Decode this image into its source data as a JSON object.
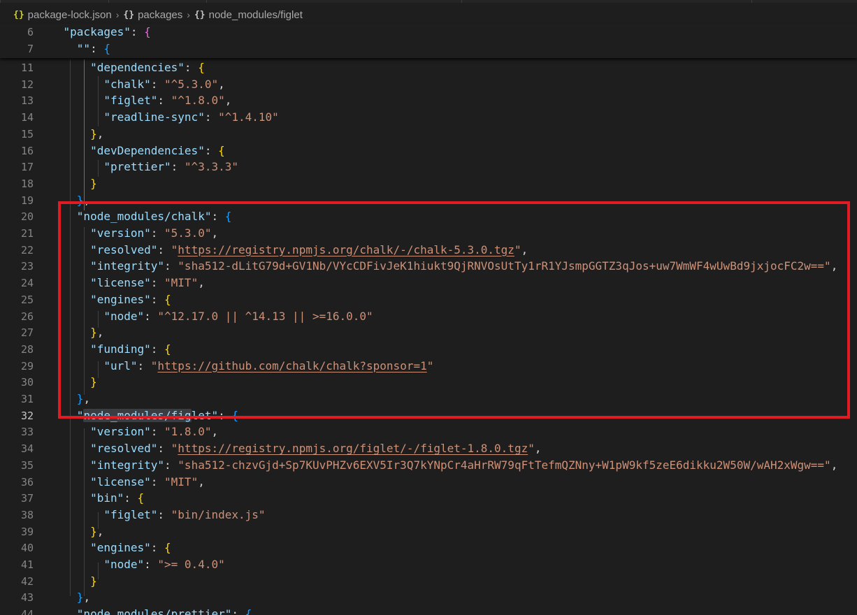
{
  "breadcrumb": {
    "file": "package-lock.json",
    "crumb1": "packages",
    "crumb2": "node_modules/figlet",
    "icon_glyph": "{}",
    "separator": "›"
  },
  "sticky_lines": [
    {
      "n": "6",
      "code": [
        [
          "    ",
          "p"
        ],
        [
          "\"packages\"",
          "k"
        ],
        [
          ": ",
          "p"
        ],
        [
          "{",
          "b2"
        ]
      ]
    },
    {
      "n": "7",
      "code": [
        [
          "      ",
          "p"
        ],
        [
          "\"\"",
          "k"
        ],
        [
          ": ",
          "p"
        ],
        [
          "{",
          "b3"
        ]
      ]
    }
  ],
  "active_line": "32",
  "lines": [
    {
      "n": "11",
      "code": [
        [
          "        ",
          "p"
        ],
        [
          "\"dependencies\"",
          "k"
        ],
        [
          ": ",
          "p"
        ],
        [
          "{",
          "b1"
        ]
      ]
    },
    {
      "n": "12",
      "code": [
        [
          "          ",
          "p"
        ],
        [
          "\"chalk\"",
          "k"
        ],
        [
          ": ",
          "p"
        ],
        [
          "\"^5.3.0\"",
          "s"
        ],
        [
          ",",
          "p"
        ]
      ]
    },
    {
      "n": "13",
      "code": [
        [
          "          ",
          "p"
        ],
        [
          "\"figlet\"",
          "k"
        ],
        [
          ": ",
          "p"
        ],
        [
          "\"^1.8.0\"",
          "s"
        ],
        [
          ",",
          "p"
        ]
      ]
    },
    {
      "n": "14",
      "code": [
        [
          "          ",
          "p"
        ],
        [
          "\"readline-sync\"",
          "k"
        ],
        [
          ": ",
          "p"
        ],
        [
          "\"^1.4.10\"",
          "s"
        ]
      ]
    },
    {
      "n": "15",
      "code": [
        [
          "        ",
          "p"
        ],
        [
          "}",
          "b1"
        ],
        [
          ",",
          "p"
        ]
      ]
    },
    {
      "n": "16",
      "code": [
        [
          "        ",
          "p"
        ],
        [
          "\"devDependencies\"",
          "k"
        ],
        [
          ": ",
          "p"
        ],
        [
          "{",
          "b1"
        ]
      ]
    },
    {
      "n": "17",
      "code": [
        [
          "          ",
          "p"
        ],
        [
          "\"prettier\"",
          "k"
        ],
        [
          ": ",
          "p"
        ],
        [
          "\"^3.3.3\"",
          "s"
        ]
      ]
    },
    {
      "n": "18",
      "code": [
        [
          "        ",
          "p"
        ],
        [
          "}",
          "b1"
        ]
      ]
    },
    {
      "n": "19",
      "code": [
        [
          "      ",
          "p"
        ],
        [
          "}",
          "b3"
        ],
        [
          ",",
          "p"
        ]
      ]
    },
    {
      "n": "20",
      "code": [
        [
          "      ",
          "p"
        ],
        [
          "\"node_modules/chalk\"",
          "k"
        ],
        [
          ": ",
          "p"
        ],
        [
          "{",
          "b3"
        ]
      ]
    },
    {
      "n": "21",
      "code": [
        [
          "        ",
          "p"
        ],
        [
          "\"version\"",
          "k"
        ],
        [
          ": ",
          "p"
        ],
        [
          "\"5.3.0\"",
          "s"
        ],
        [
          ",",
          "p"
        ]
      ]
    },
    {
      "n": "22",
      "code": [
        [
          "        ",
          "p"
        ],
        [
          "\"resolved\"",
          "k"
        ],
        [
          ": ",
          "p"
        ],
        [
          "\"",
          "s"
        ],
        [
          "https://registry.npmjs.org/chalk/-/chalk-5.3.0.tgz",
          "u"
        ],
        [
          "\"",
          "s"
        ],
        [
          ",",
          "p"
        ]
      ]
    },
    {
      "n": "23",
      "code": [
        [
          "        ",
          "p"
        ],
        [
          "\"integrity\"",
          "k"
        ],
        [
          ": ",
          "p"
        ],
        [
          "\"sha512-dLitG79d+GV1Nb/VYcCDFivJeK1hiukt9QjRNVOsUtTy1rR1YJsmpGGTZ3qJos+uw7WmWF4wUwBd9jxjocFC2w==\"",
          "s"
        ],
        [
          ",",
          "p"
        ]
      ]
    },
    {
      "n": "24",
      "code": [
        [
          "        ",
          "p"
        ],
        [
          "\"license\"",
          "k"
        ],
        [
          ": ",
          "p"
        ],
        [
          "\"MIT\"",
          "s"
        ],
        [
          ",",
          "p"
        ]
      ]
    },
    {
      "n": "25",
      "code": [
        [
          "        ",
          "p"
        ],
        [
          "\"engines\"",
          "k"
        ],
        [
          ": ",
          "p"
        ],
        [
          "{",
          "b1"
        ]
      ]
    },
    {
      "n": "26",
      "code": [
        [
          "          ",
          "p"
        ],
        [
          "\"node\"",
          "k"
        ],
        [
          ": ",
          "p"
        ],
        [
          "\"^12.17.0 || ^14.13 || >=16.0.0\"",
          "s"
        ]
      ]
    },
    {
      "n": "27",
      "code": [
        [
          "        ",
          "p"
        ],
        [
          "}",
          "b1"
        ],
        [
          ",",
          "p"
        ]
      ]
    },
    {
      "n": "28",
      "code": [
        [
          "        ",
          "p"
        ],
        [
          "\"funding\"",
          "k"
        ],
        [
          ": ",
          "p"
        ],
        [
          "{",
          "b1"
        ]
      ]
    },
    {
      "n": "29",
      "code": [
        [
          "          ",
          "p"
        ],
        [
          "\"url\"",
          "k"
        ],
        [
          ": ",
          "p"
        ],
        [
          "\"",
          "s"
        ],
        [
          "https://github.com/chalk/chalk?sponsor=1",
          "u"
        ],
        [
          "\"",
          "s"
        ]
      ]
    },
    {
      "n": "30",
      "code": [
        [
          "        ",
          "p"
        ],
        [
          "}",
          "b1"
        ]
      ]
    },
    {
      "n": "31",
      "code": [
        [
          "      ",
          "p"
        ],
        [
          "}",
          "b3"
        ],
        [
          ",",
          "p"
        ]
      ]
    },
    {
      "n": "32",
      "code": [
        [
          "      ",
          "p"
        ],
        [
          "\"",
          "k"
        ],
        [
          "node_modules/fig",
          "k hl"
        ],
        [
          "let\"",
          "k"
        ],
        [
          ": ",
          "p"
        ],
        [
          "{",
          "b3"
        ]
      ]
    },
    {
      "n": "33",
      "code": [
        [
          "        ",
          "p"
        ],
        [
          "\"version\"",
          "k"
        ],
        [
          ": ",
          "p"
        ],
        [
          "\"1.8.0\"",
          "s"
        ],
        [
          ",",
          "p"
        ]
      ]
    },
    {
      "n": "34",
      "code": [
        [
          "        ",
          "p"
        ],
        [
          "\"resolved\"",
          "k"
        ],
        [
          ": ",
          "p"
        ],
        [
          "\"",
          "s"
        ],
        [
          "https://registry.npmjs.org/figlet/-/figlet-1.8.0.tgz",
          "u"
        ],
        [
          "\"",
          "s"
        ],
        [
          ",",
          "p"
        ]
      ]
    },
    {
      "n": "35",
      "code": [
        [
          "        ",
          "p"
        ],
        [
          "\"integrity\"",
          "k"
        ],
        [
          ": ",
          "p"
        ],
        [
          "\"sha512-chzvGjd+Sp7KUvPHZv6EXV5Ir3Q7kYNpCr4aHrRW79qFtTefmQZNny+W1pW9kf5zeE6dikku2W50W/wAH2xWgw==\"",
          "s"
        ],
        [
          ",",
          "p"
        ]
      ]
    },
    {
      "n": "36",
      "code": [
        [
          "        ",
          "p"
        ],
        [
          "\"license\"",
          "k"
        ],
        [
          ": ",
          "p"
        ],
        [
          "\"MIT\"",
          "s"
        ],
        [
          ",",
          "p"
        ]
      ]
    },
    {
      "n": "37",
      "code": [
        [
          "        ",
          "p"
        ],
        [
          "\"bin\"",
          "k"
        ],
        [
          ": ",
          "p"
        ],
        [
          "{",
          "b1"
        ]
      ]
    },
    {
      "n": "38",
      "code": [
        [
          "          ",
          "p"
        ],
        [
          "\"figlet\"",
          "k"
        ],
        [
          ": ",
          "p"
        ],
        [
          "\"bin/index.js\"",
          "s"
        ]
      ]
    },
    {
      "n": "39",
      "code": [
        [
          "        ",
          "p"
        ],
        [
          "}",
          "b1"
        ],
        [
          ",",
          "p"
        ]
      ]
    },
    {
      "n": "40",
      "code": [
        [
          "        ",
          "p"
        ],
        [
          "\"engines\"",
          "k"
        ],
        [
          ": ",
          "p"
        ],
        [
          "{",
          "b1"
        ]
      ]
    },
    {
      "n": "41",
      "code": [
        [
          "          ",
          "p"
        ],
        [
          "\"node\"",
          "k"
        ],
        [
          ": ",
          "p"
        ],
        [
          "\">= 0.4.0\"",
          "s"
        ]
      ]
    },
    {
      "n": "42",
      "code": [
        [
          "        ",
          "p"
        ],
        [
          "}",
          "b1"
        ]
      ]
    },
    {
      "n": "43",
      "code": [
        [
          "      ",
          "p"
        ],
        [
          "}",
          "b3"
        ],
        [
          ",",
          "p"
        ]
      ]
    },
    {
      "n": "44",
      "code": [
        [
          "      ",
          "p"
        ],
        [
          "\"node_modules/prettier\"",
          "k"
        ],
        [
          ": ",
          "p"
        ],
        [
          "{",
          "b3"
        ]
      ]
    }
  ],
  "colors": {
    "background": "#1e1e1e",
    "key": "#9cdcfe",
    "string": "#ce9178",
    "bracket_level1": "#ffd700",
    "bracket_level2": "#da70d6",
    "bracket_level3": "#179fff",
    "annotation_box": "#e01b24"
  }
}
